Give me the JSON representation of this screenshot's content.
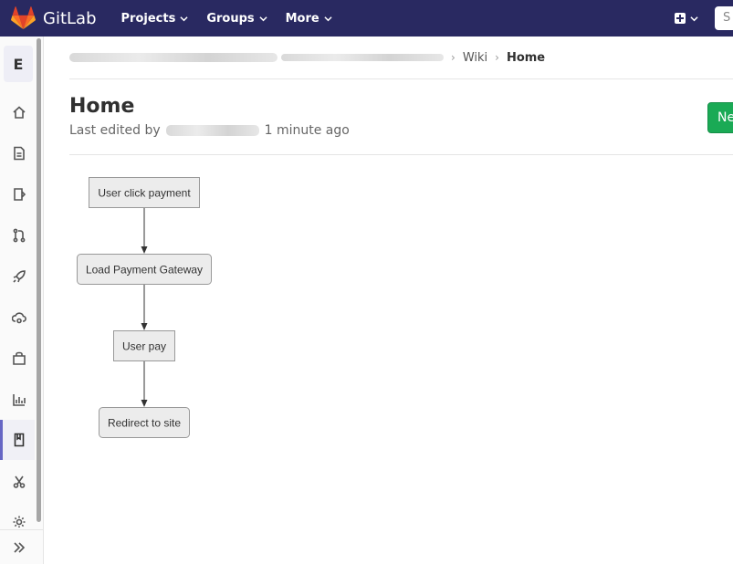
{
  "navbar": {
    "brand": "GitLab",
    "menu": [
      {
        "label": "Projects"
      },
      {
        "label": "Groups"
      },
      {
        "label": "More"
      }
    ],
    "search_stub": "S",
    "colors": {
      "background": "#292961",
      "logo_orange": "#fc6d26",
      "logo_red": "#e24329",
      "logo_light": "#fca326"
    }
  },
  "sidebar": {
    "project_letter": "E",
    "items": [
      {
        "icon": "home-icon"
      },
      {
        "icon": "document-icon"
      },
      {
        "icon": "issues-icon"
      },
      {
        "icon": "merge-request-icon"
      },
      {
        "icon": "rocket-icon"
      },
      {
        "icon": "cloud-gear-icon"
      },
      {
        "icon": "package-icon"
      },
      {
        "icon": "chart-icon"
      },
      {
        "icon": "wiki-book-icon",
        "active": true
      },
      {
        "icon": "snippets-scissors-icon"
      },
      {
        "icon": "settings-icon"
      }
    ],
    "collapse_icon": "double-chevron-right-icon"
  },
  "breadcrumb": {
    "items": [
      "Wiki",
      "Home"
    ]
  },
  "page": {
    "title": "Home",
    "meta_prefix": "Last edited by",
    "meta_suffix": "1 minute ago",
    "new_button_label": "Ne",
    "accent": "#1aaa55"
  },
  "flowchart": {
    "nodes": [
      {
        "id": "n1",
        "label": "User click payment"
      },
      {
        "id": "n2",
        "label": "Load Payment Gateway"
      },
      {
        "id": "n3",
        "label": "User pay"
      },
      {
        "id": "n4",
        "label": "Redirect to site"
      }
    ],
    "edges": [
      {
        "from": "n1",
        "to": "n2"
      },
      {
        "from": "n2",
        "to": "n3"
      },
      {
        "from": "n3",
        "to": "n4"
      }
    ]
  }
}
